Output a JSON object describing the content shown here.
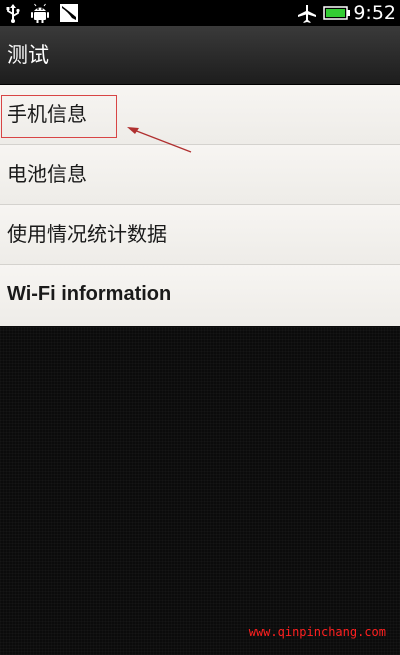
{
  "status_bar": {
    "time": "9:52",
    "icons": [
      "usb-icon",
      "android-debug-icon",
      "notification-icon",
      "airplane-mode-icon",
      "battery-icon"
    ]
  },
  "title_bar": {
    "title": "测试"
  },
  "menu": {
    "items": [
      {
        "label": "手机信息"
      },
      {
        "label": "电池信息"
      },
      {
        "label": "使用情况统计数据"
      },
      {
        "label": "Wi-Fi information"
      }
    ]
  },
  "annotation": {
    "highlight_color": "#d84545"
  },
  "watermark": {
    "text": "www.qinpinchang.com",
    "color": "#ff2020"
  }
}
